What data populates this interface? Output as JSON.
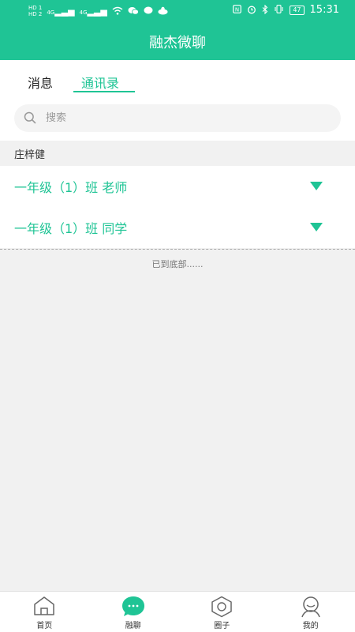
{
  "status_bar": {
    "sim1": "HD 1",
    "sim2": "HD 2",
    "net1": "4G",
    "net2": "4G",
    "battery": "47",
    "time": "15:31"
  },
  "header": {
    "title": "融杰微聊"
  },
  "tabs": [
    {
      "label": "消息",
      "active": false
    },
    {
      "label": "通讯录",
      "active": true
    }
  ],
  "search": {
    "placeholder": "搜索",
    "value": ""
  },
  "section": {
    "title": "庄梓健"
  },
  "groups": [
    {
      "label": "一年级（1）班 老师"
    },
    {
      "label": "一年级（1）班 同学"
    }
  ],
  "list_end": "已到底部......",
  "bottom_nav": [
    {
      "label": "首页",
      "icon": "home-icon"
    },
    {
      "label": "融聊",
      "icon": "chat-icon",
      "active": true
    },
    {
      "label": "圈子",
      "icon": "circle-icon"
    },
    {
      "label": "我的",
      "icon": "profile-icon"
    }
  ],
  "colors": {
    "accent": "#1fc495",
    "background": "#f1f1f1"
  }
}
